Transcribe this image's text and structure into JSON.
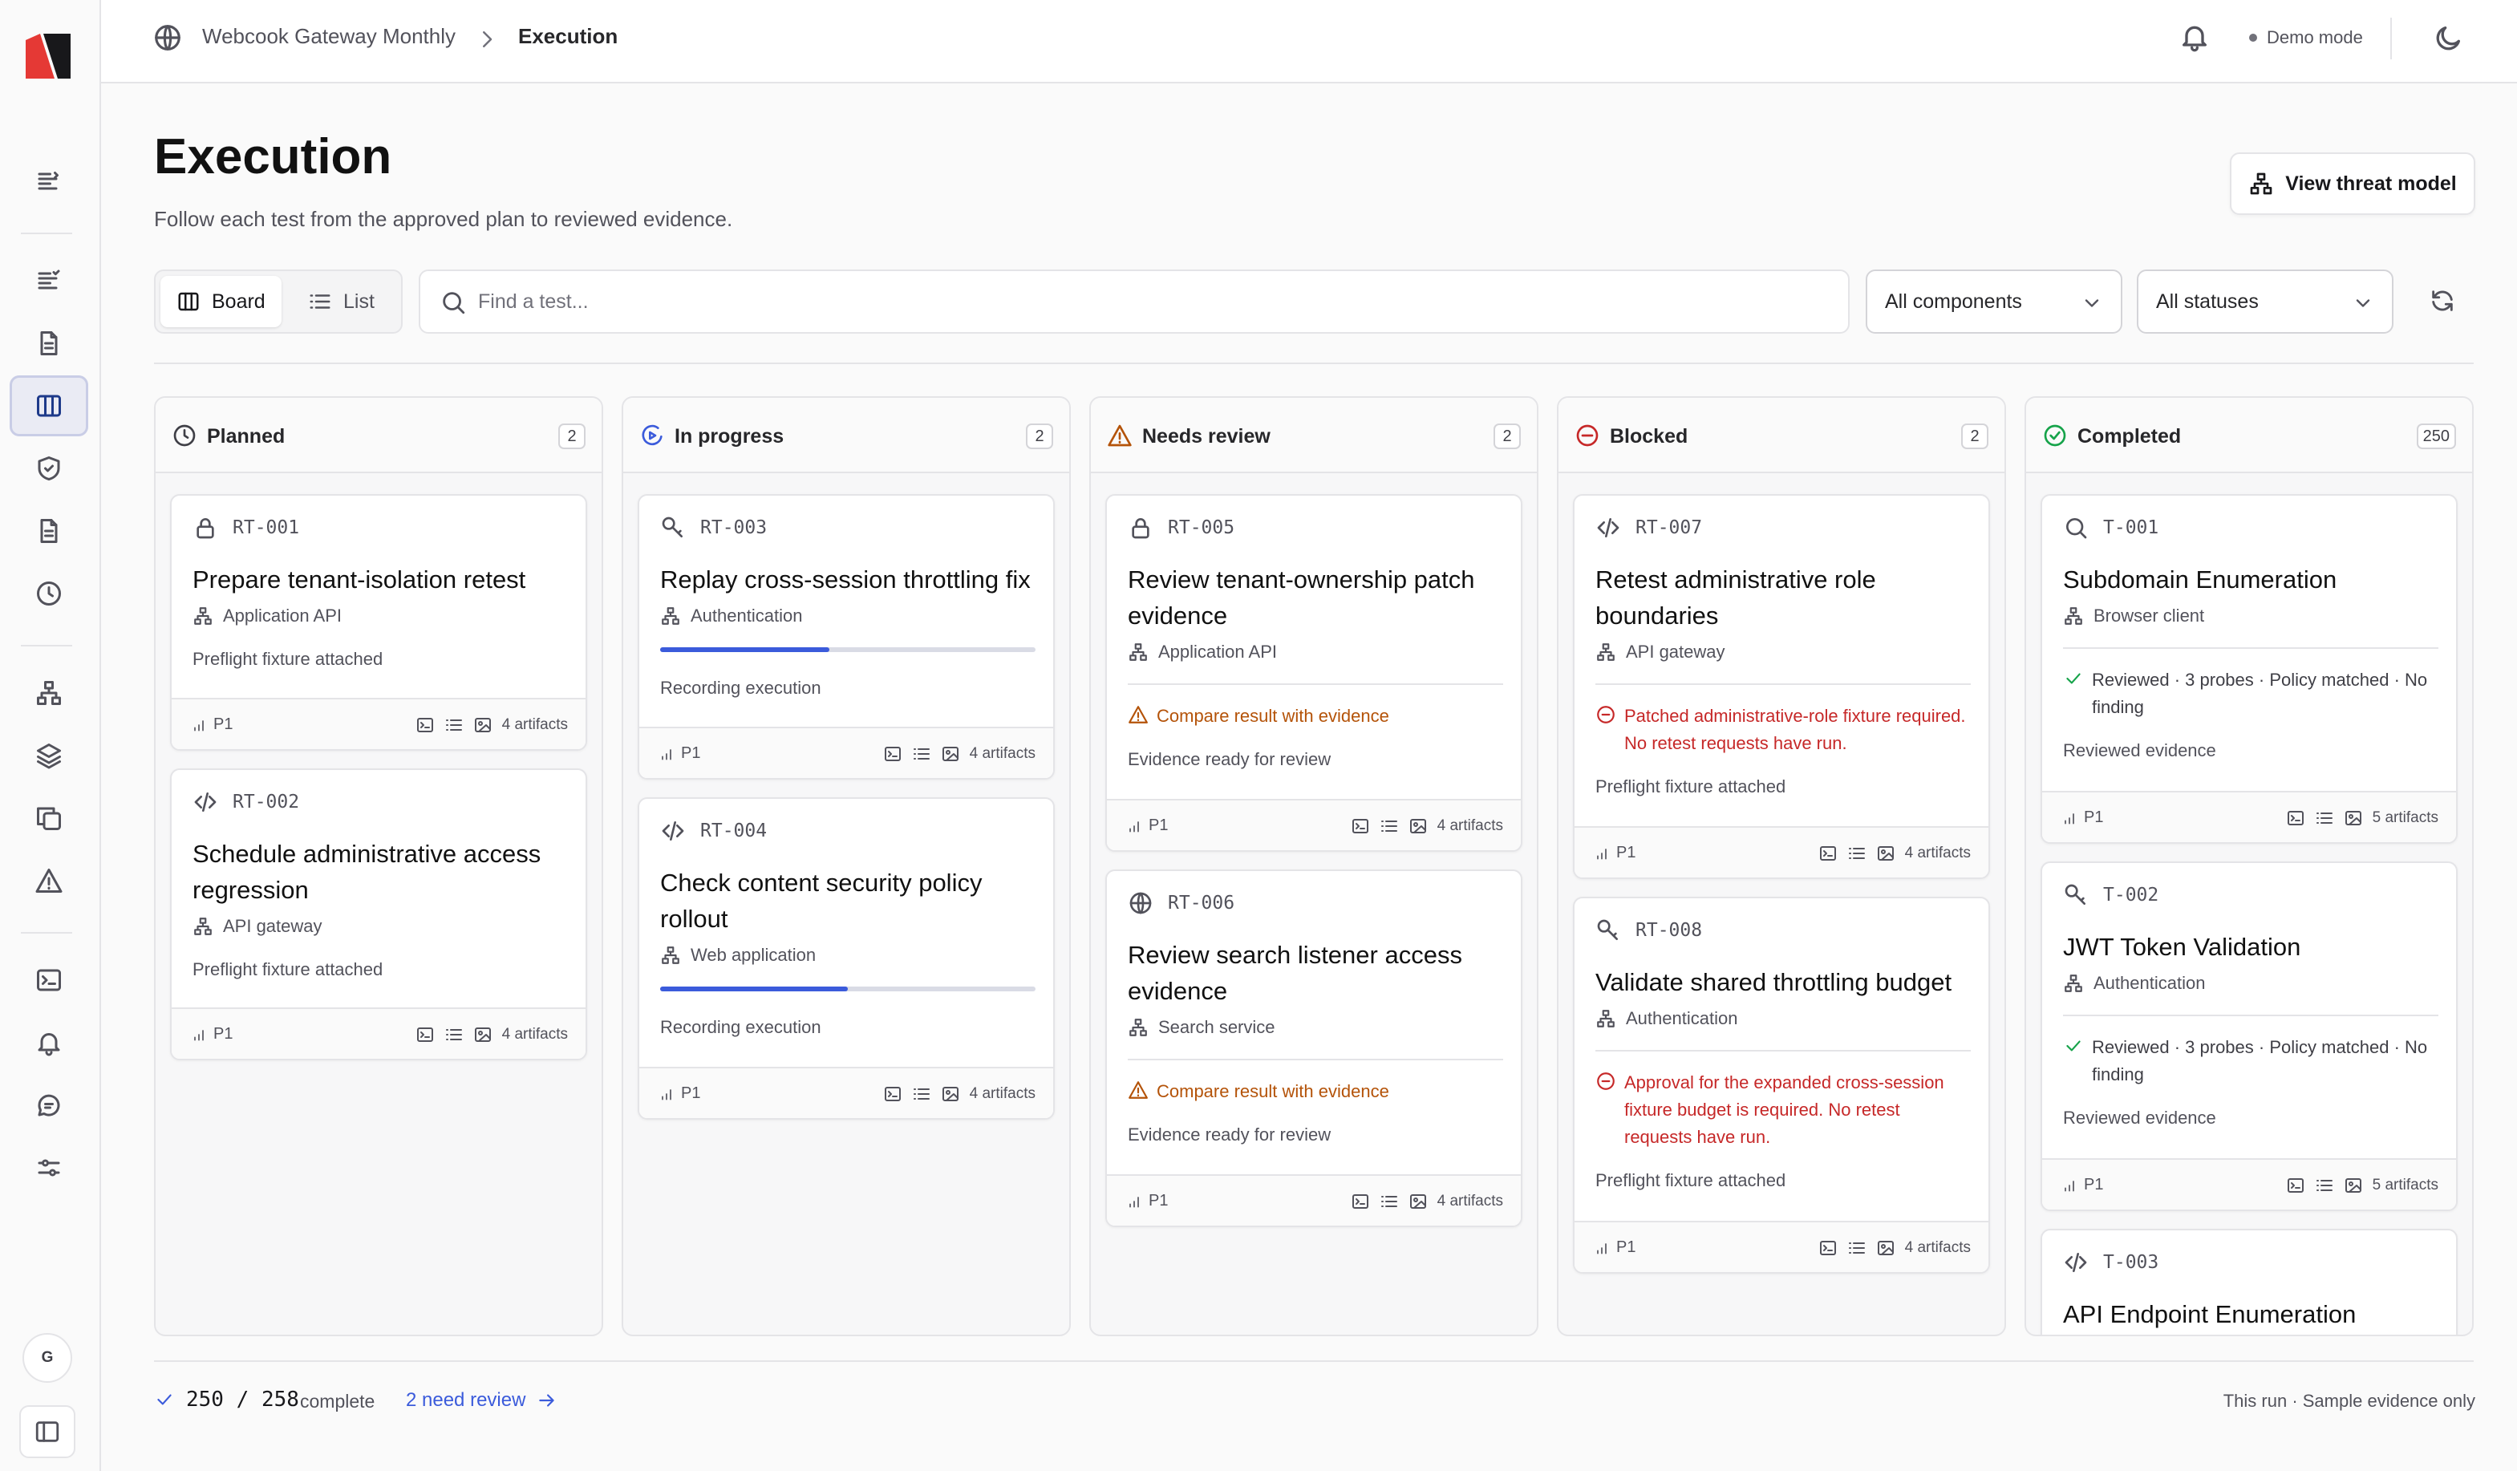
{
  "topbar": {
    "project": "Webcook Gateway Monthly",
    "page": "Execution",
    "demo_mode": "Demo mode"
  },
  "header": {
    "title": "Execution",
    "subtitle": "Follow each test from the approved plan to reviewed evidence.",
    "threat_button": "View threat model"
  },
  "toolbar": {
    "view_board": "Board",
    "view_list": "List",
    "search_placeholder": "Find a test...",
    "components_filter": "All components",
    "statuses_filter": "All statuses"
  },
  "sidebar": {
    "avatar": "G"
  },
  "columns": [
    {
      "title": "Planned",
      "count": "2",
      "status_icon": "clock-icon",
      "cards": [
        {
          "id": "RT-001",
          "icon": "lock-icon",
          "title": "Prepare tenant-isolation retest",
          "component": "Application API",
          "note": "Preflight fixture attached",
          "priority": "P1",
          "artifacts": "4 artifacts"
        },
        {
          "id": "RT-002",
          "icon": "code-icon",
          "title": "Schedule administrative access regression",
          "component": "API gateway",
          "note": "Preflight fixture attached",
          "priority": "P1",
          "artifacts": "4 artifacts"
        }
      ]
    },
    {
      "title": "In progress",
      "count": "2",
      "status_icon": "play-circle-icon",
      "cards": [
        {
          "id": "RT-003",
          "icon": "key-icon",
          "title": "Replay cross-session throttling fix",
          "component": "Authentication",
          "progress": 0.45,
          "note": "Recording execution",
          "priority": "P1",
          "artifacts": "4 artifacts"
        },
        {
          "id": "RT-004",
          "icon": "code-icon",
          "title": "Check content security policy rollout",
          "component": "Web application",
          "progress": 0.5,
          "note": "Recording execution",
          "priority": "P1",
          "artifacts": "4 artifacts"
        }
      ]
    },
    {
      "title": "Needs review",
      "count": "2",
      "status_icon": "warning-icon",
      "cards": [
        {
          "id": "RT-005",
          "icon": "lock-icon",
          "title": "Review tenant-ownership patch evidence",
          "component": "Application API",
          "alert": "Compare result with evidence",
          "note": "Evidence ready for review",
          "priority": "P1",
          "artifacts": "4 artifacts"
        },
        {
          "id": "RT-006",
          "icon": "globe-icon",
          "title": "Review search listener access evidence",
          "component": "Search service",
          "alert": "Compare result with evidence",
          "note": "Evidence ready for review",
          "priority": "P1",
          "artifacts": "4 artifacts"
        }
      ]
    },
    {
      "title": "Blocked",
      "count": "2",
      "status_icon": "blocked-icon",
      "cards": [
        {
          "id": "RT-007",
          "icon": "code-icon",
          "title": "Retest administrative role boundaries",
          "component": "API gateway",
          "alert": "Patched administrative-role fixture required. No retest requests have run.",
          "note": "Preflight fixture attached",
          "priority": "P1",
          "artifacts": "4 artifacts"
        },
        {
          "id": "RT-008",
          "icon": "key-icon",
          "title": "Validate shared throttling budget",
          "component": "Authentication",
          "alert": "Approval for the expanded cross-session fixture budget is required. No retest requests have run.",
          "note": "Preflight fixture attached",
          "priority": "P1",
          "artifacts": "4 artifacts"
        }
      ]
    },
    {
      "title": "Completed",
      "count": "250",
      "status_icon": "check-circle-icon",
      "cards": [
        {
          "id": "T-001",
          "icon": "search-icon",
          "title": "Subdomain Enumeration",
          "component": "Browser client",
          "alert": "Reviewed · 3 probes · Policy matched · No finding",
          "note": "Reviewed evidence",
          "priority": "P1",
          "artifacts": "5 artifacts"
        },
        {
          "id": "T-002",
          "icon": "key-icon",
          "title": "JWT Token Validation",
          "component": "Authentication",
          "alert": "Reviewed · 3 probes · Policy matched · No finding",
          "note": "Reviewed evidence",
          "priority": "P1",
          "artifacts": "5 artifacts"
        },
        {
          "id": "T-003",
          "icon": "code-icon",
          "title": "API Endpoint Enumeration"
        }
      ]
    }
  ],
  "footer": {
    "completed": "250",
    "total": "258",
    "complete_label": "complete",
    "review_link": "2 need review",
    "run_note": "This run · Sample evidence only"
  },
  "colors": {
    "accent": "#3b5bdb",
    "warning": "#b45309",
    "danger": "#c62828",
    "success": "#16a34a"
  }
}
